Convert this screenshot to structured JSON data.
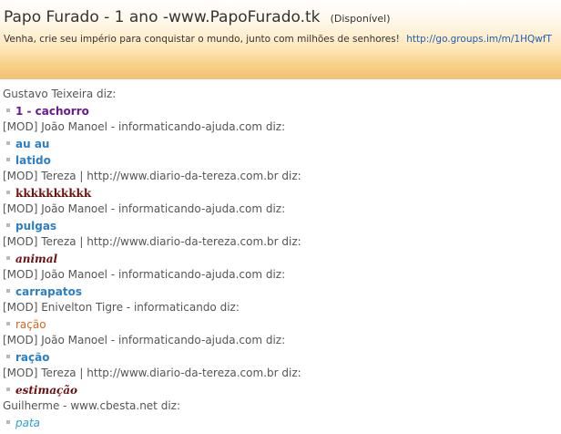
{
  "header": {
    "title": "Papo Furado - 1 ano -www.PapoFurado.tk",
    "status": "(Disponível)",
    "subtitle": "Venha, crie seu império para conquistar o mundo, junto com milhões de senhores!",
    "link": "http://go.groups.im/m/1HQwfT"
  },
  "colors": {
    "purple": "#6a1b8f",
    "blue": "#2b7fc6",
    "maroon": "#6b1010",
    "orange": "#d2691e",
    "light_blue": "#2ba0d8",
    "header_gradient_bottom": "#f2c277"
  },
  "messages": [
    {
      "sender": "Gustavo Teixeira diz:",
      "lines": [
        "1 - cachorro"
      ],
      "style": "purple"
    },
    {
      "sender": "[MOD] João Manoel - informaticando-ajuda.com diz:",
      "lines": [
        "au au",
        "latido"
      ],
      "style": "blue"
    },
    {
      "sender": "[MOD] Tereza | http://www.diario-da-tereza.com.br diz:",
      "lines": [
        "kkkkkkkkkk"
      ],
      "style": "maroon-bold"
    },
    {
      "sender": "[MOD] João Manoel - informaticando-ajuda.com diz:",
      "lines": [
        "pulgas"
      ],
      "style": "blue"
    },
    {
      "sender": "[MOD] Tereza | http://www.diario-da-tereza.com.br diz:",
      "lines": [
        "animal"
      ],
      "style": "maroon-italic"
    },
    {
      "sender": "[MOD] João Manoel - informaticando-ajuda.com diz:",
      "lines": [
        "carrapatos"
      ],
      "style": "blue"
    },
    {
      "sender": "[MOD] Enivelton Tigre - informaticando diz:",
      "lines": [
        "ração"
      ],
      "style": "orange"
    },
    {
      "sender": "[MOD] João Manoel - informaticando-ajuda.com diz:",
      "lines": [
        "ração"
      ],
      "style": "blue"
    },
    {
      "sender": "[MOD] Tereza | http://www.diario-da-tereza.com.br diz:",
      "lines": [
        "estimação"
      ],
      "style": "maroon-italic"
    },
    {
      "sender": "Guilherme - www.cbesta.net diz:",
      "lines": [
        "pata"
      ],
      "style": "lightblue-italic"
    }
  ]
}
